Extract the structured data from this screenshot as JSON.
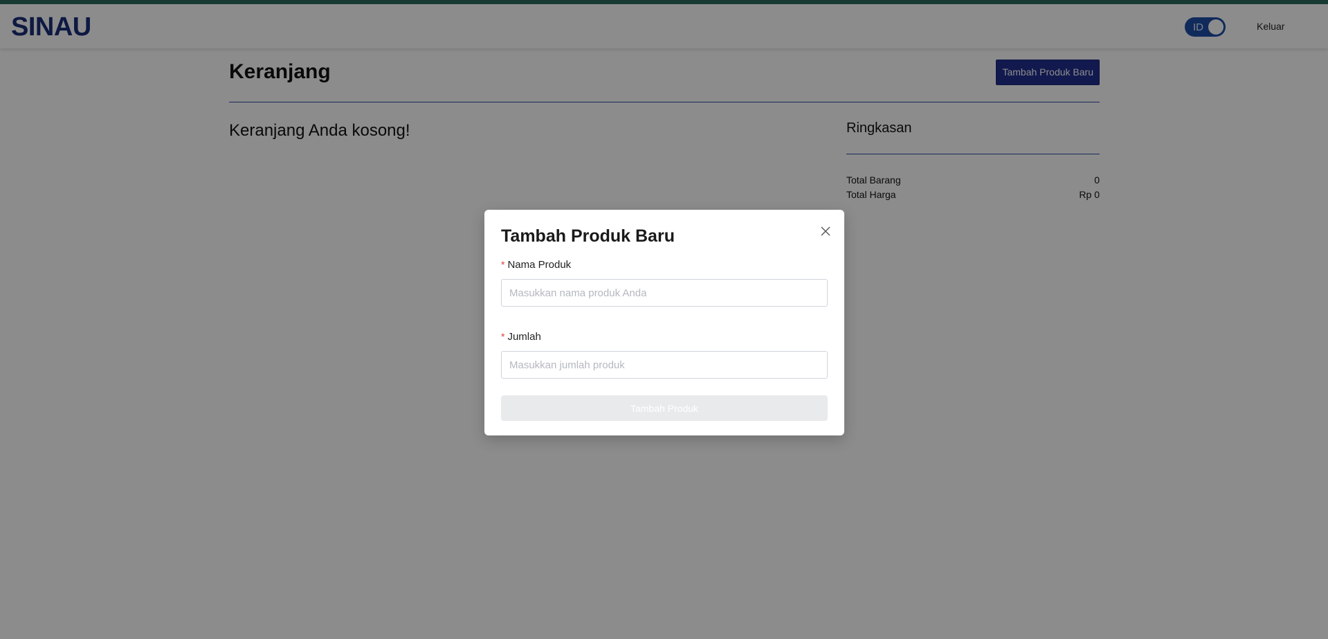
{
  "header": {
    "logo": "SINAU",
    "language_toggle_label": "ID",
    "logout_label": "Keluar"
  },
  "main": {
    "title": "Keranjang",
    "add_new_button": "Tambah Produk Baru",
    "empty_message": "Keranjang Anda kosong!"
  },
  "summary": {
    "title": "Ringkasan",
    "rows": [
      {
        "label": "Total Barang",
        "value": "0"
      },
      {
        "label": "Total Harga",
        "value": "Rp 0"
      }
    ]
  },
  "modal": {
    "title": "Tambah Produk Baru",
    "fields": [
      {
        "label": "Nama Produk",
        "value": "",
        "placeholder": "Masukkan nama produk Anda",
        "required": true
      },
      {
        "label": "Jumlah",
        "value": "",
        "placeholder": "Masukkan jumlah produk",
        "required": true
      }
    ],
    "submit_label": "Tambah Produk"
  },
  "colors": {
    "brand": "#1b2f7a",
    "primary_button": "#1f2f8f",
    "accent_strip": "#2d6b5e",
    "required_marker": "#e53935",
    "overlay": "rgba(0,0,0,0.45)"
  },
  "icons": {
    "close": "close-icon"
  }
}
